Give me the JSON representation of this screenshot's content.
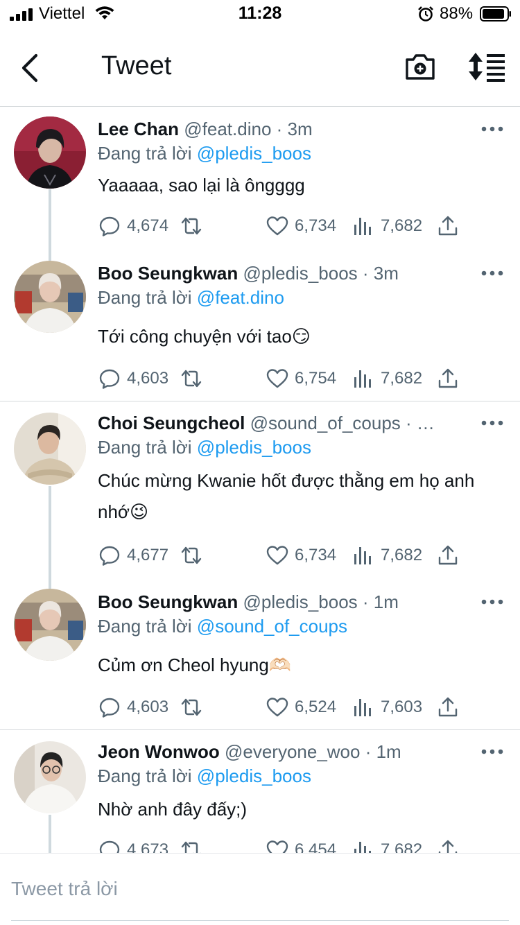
{
  "status_bar": {
    "carrier": "Viettel",
    "time": "11:28",
    "battery": "88%"
  },
  "nav": {
    "title": "Tweet"
  },
  "tweets": [
    {
      "name": "Lee Chan",
      "handle": "@feat.dino · 3m",
      "replying_label": "Đang trả lời",
      "replying_to": "@pledis_boos",
      "text": "Yaaaaa, sao lại là ôngggg",
      "replies": "4,674",
      "likes": "6,734",
      "views": "7,682"
    },
    {
      "name": "Boo Seungkwan",
      "handle": "@pledis_boos · 3m",
      "replying_label": "Đang trả lời",
      "replying_to": "@feat.dino",
      "text": "Tới công chuyện với tao😏",
      "replies": "4,603",
      "likes": "6,754",
      "views": "7,682"
    },
    {
      "name": "Choi Seungcheol",
      "handle": "@sound_of_coups · …",
      "replying_label": "Đang trả lời",
      "replying_to": "@pledis_boos",
      "text": "Chúc mừng Kwanie hốt được thằng em họ anh nhớ😉",
      "replies": "4,677",
      "likes": "6,734",
      "views": "7,682"
    },
    {
      "name": "Boo Seungkwan",
      "handle": "@pledis_boos · 1m",
      "replying_label": "Đang trả lời",
      "replying_to": "@sound_of_coups",
      "text": "Củm ơn Cheol hyung🫶🏻",
      "replies": "4,603",
      "likes": "6,524",
      "views": "7,603"
    },
    {
      "name": "Jeon Wonwoo",
      "handle": "@everyone_woo · 1m",
      "replying_label": "Đang trả lời",
      "replying_to": "@pledis_boos",
      "text": "Nhờ anh đây đấy;)",
      "replies": "4,673",
      "likes": "6,454",
      "views": "7,682"
    }
  ],
  "composer": {
    "placeholder": "Tweet trả lời"
  },
  "colors": {
    "accent": "#1d9bf0",
    "secondary_text": "#536471",
    "divider": "#d4d8db"
  },
  "icons": [
    "back-arrow-icon",
    "camera-add-icon",
    "sort-list-icon",
    "more-dots-icon",
    "reply-bubble-icon",
    "retweet-icon",
    "heart-icon",
    "views-bars-icon",
    "share-upload-icon"
  ]
}
